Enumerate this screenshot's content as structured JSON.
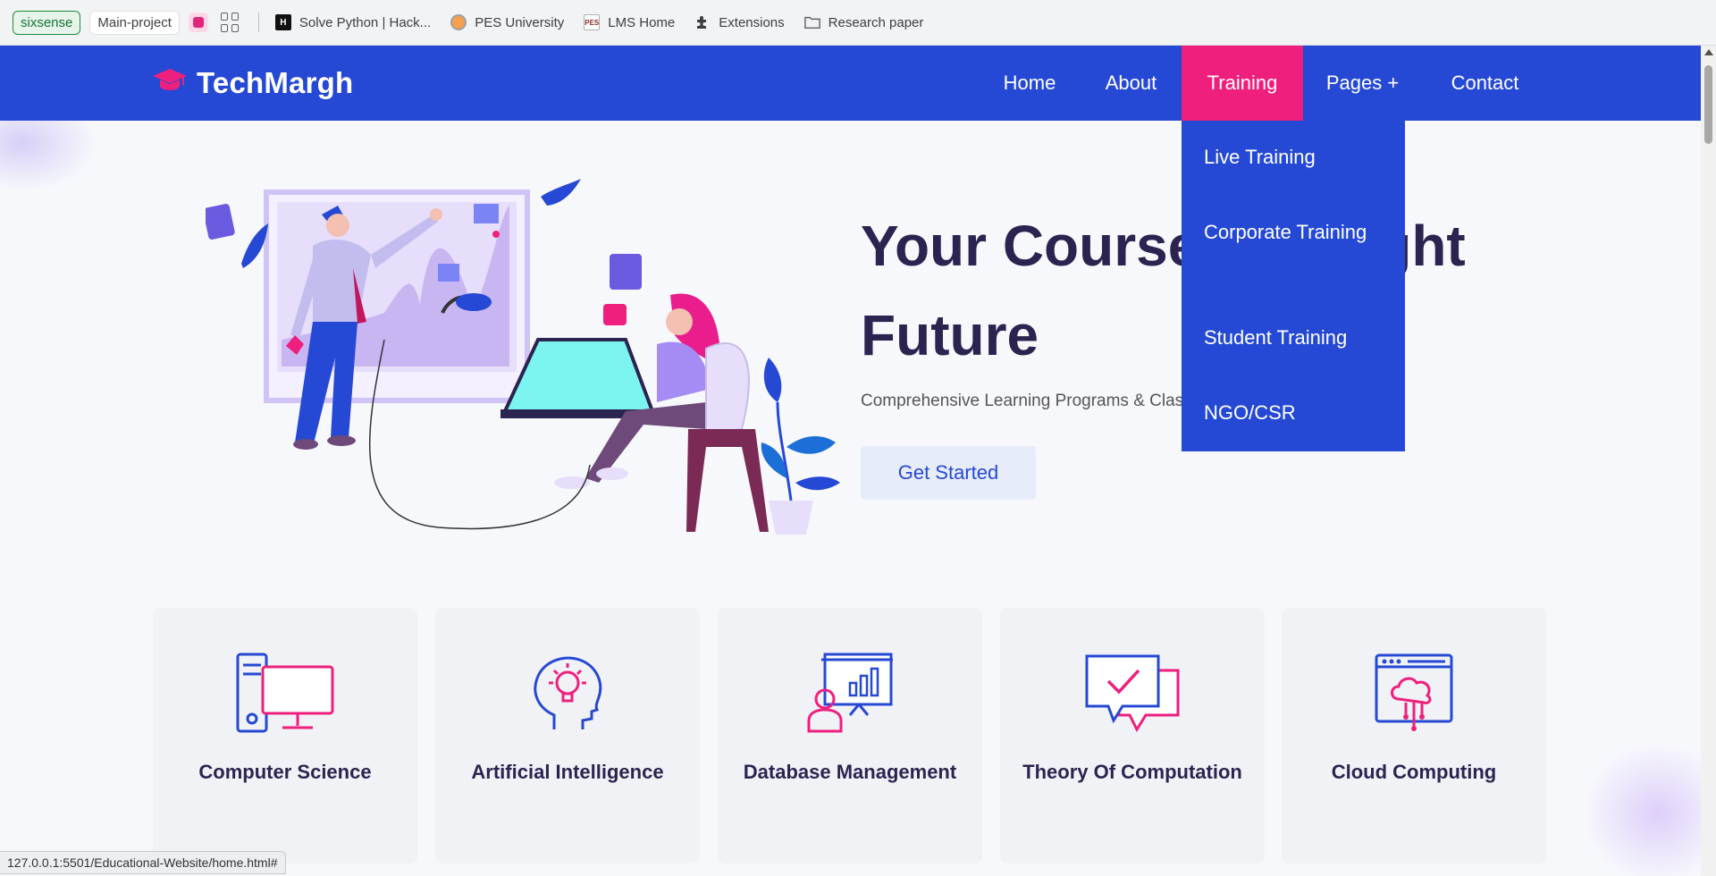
{
  "bookmarks_bar": {
    "profile_chip": "sixsense",
    "project_chip": "Main-project",
    "items": [
      {
        "label": "Solve Python | Hack...",
        "icon": "hackerrank-icon"
      },
      {
        "label": "PES University",
        "icon": "pes-university-icon"
      },
      {
        "label": "LMS Home",
        "icon": "lms-icon"
      },
      {
        "label": "Extensions",
        "icon": "puzzle-piece-icon"
      },
      {
        "label": "Research paper",
        "icon": "folder-icon"
      }
    ],
    "hackerrank_glyph": "H",
    "lms_glyph": "PES"
  },
  "navbar": {
    "brand": "TechMargh",
    "brand_icon": "graduation-cap-icon",
    "links": [
      "Home",
      "About",
      "Training",
      "Pages +",
      "Contact"
    ],
    "active_link": "Training",
    "dropdown": [
      "Live Training",
      "Corporate Training",
      "Student Training",
      "NGO/CSR"
    ]
  },
  "hero": {
    "title": "Your Course To Bright Future",
    "subtitle": "Comprehensive Learning Programs & Classes",
    "cta_label": "Get Started",
    "illustration": "people-learning-illustration"
  },
  "courses": [
    {
      "label": "Computer Science",
      "icon": "computer-desktop-icon"
    },
    {
      "label": "Artificial Intelligence",
      "icon": "head-lightbulb-icon"
    },
    {
      "label": "Database Management",
      "icon": "presentation-board-icon"
    },
    {
      "label": "Theory Of Computation",
      "icon": "chat-check-icon"
    },
    {
      "label": "Cloud Computing",
      "icon": "cloud-browser-icon"
    }
  ],
  "status_bar": {
    "url": "127.0.0.1:5501/Educational-Website/home.html#"
  },
  "colors": {
    "primary": "#2549d4",
    "accent": "#ef1f7d",
    "text_dark": "#2b2450",
    "page_background": "#f7f8fc"
  }
}
